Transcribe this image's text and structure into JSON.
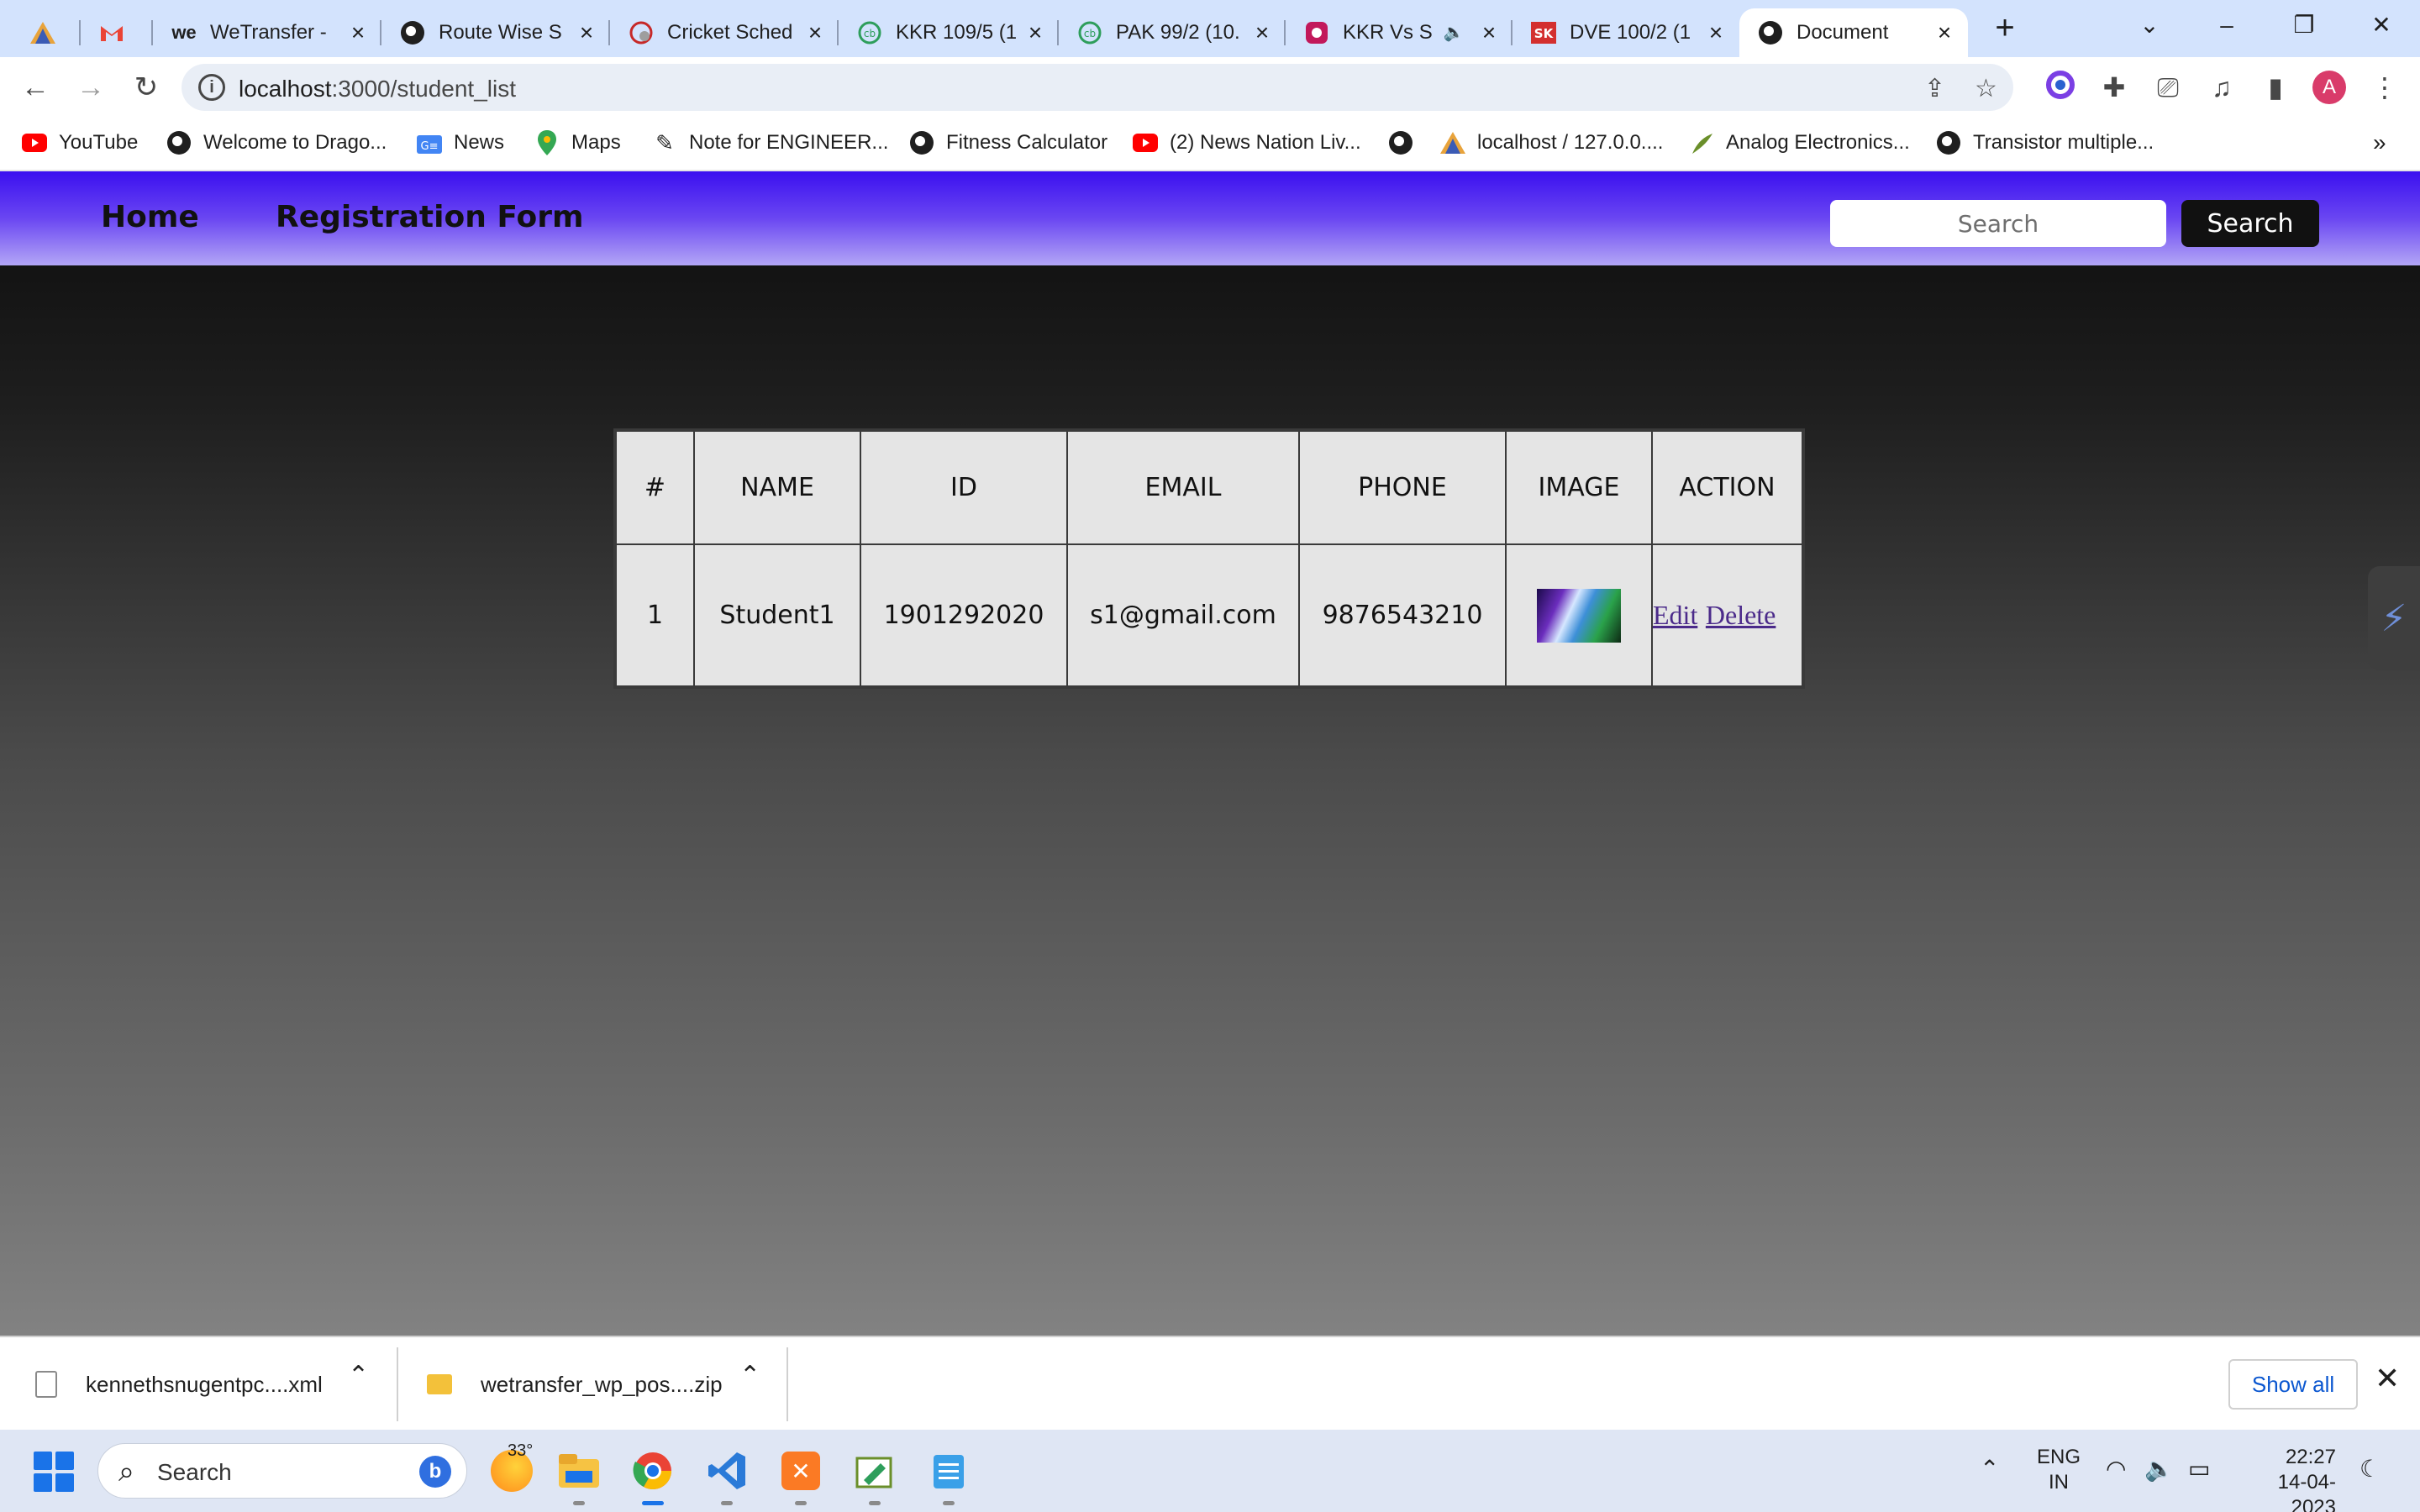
{
  "browser": {
    "tabs": [
      {
        "title": "",
        "icon": "pma-icon"
      },
      {
        "title": "",
        "icon": "gmail-icon"
      },
      {
        "title": "WeTransfer -",
        "icon": "wetransfer-icon"
      },
      {
        "title": "Route Wise S",
        "icon": "globe-icon"
      },
      {
        "title": "Cricket Sched",
        "icon": "cricket-icon"
      },
      {
        "title": "KKR 109/5 (1",
        "icon": "cricbuzz-icon"
      },
      {
        "title": "PAK 99/2 (10.",
        "icon": "cricbuzz-icon"
      },
      {
        "title": "KKR Vs S",
        "icon": "video-icon"
      },
      {
        "title": "DVE 100/2 (1",
        "icon": "sk-icon"
      },
      {
        "title": "Document",
        "icon": "globe-icon"
      }
    ],
    "url_host": "localhost",
    "url_path": ":3000/student_list",
    "profile_initial": "A",
    "bookmarks": [
      {
        "label": "YouTube"
      },
      {
        "label": "Welcome to Drago..."
      },
      {
        "label": "News"
      },
      {
        "label": "Maps"
      },
      {
        "label": "Note for ENGINEER..."
      },
      {
        "label": "Fitness Calculator"
      },
      {
        "label": "(2) News Nation Liv..."
      },
      {
        "label": ""
      },
      {
        "label": "localhost / 127.0.0...."
      },
      {
        "label": "Analog Electronics..."
      },
      {
        "label": "Transistor multiple..."
      }
    ]
  },
  "page": {
    "nav": {
      "home": "Home",
      "register": "Registration Form"
    },
    "search": {
      "placeholder": "Search",
      "button": "Search"
    },
    "table": {
      "headers": [
        "#",
        "NAME",
        "ID",
        "EMAIL",
        "PHONE",
        "IMAGE",
        "ACTION"
      ],
      "rows": [
        {
          "num": "1",
          "name": "Student1",
          "id": "1901292020",
          "email": "s1@gmail.com",
          "phone": "9876543210",
          "edit": "Edit",
          "delete": "Delete"
        }
      ]
    }
  },
  "downloads": {
    "items": [
      {
        "name": "kennethsnugentpc....xml"
      },
      {
        "name": "wetransfer_wp_pos....zip"
      }
    ],
    "show_all": "Show all"
  },
  "taskbar": {
    "search": "Search",
    "temperature": "33°",
    "lang_line1": "ENG",
    "lang_line2": "IN",
    "time": "22:27",
    "date": "14-04-2023"
  },
  "colors": {
    "navbar_start": "#3b10f0",
    "navbar_end": "#b3a6f6",
    "link": "#4b2a8a"
  }
}
